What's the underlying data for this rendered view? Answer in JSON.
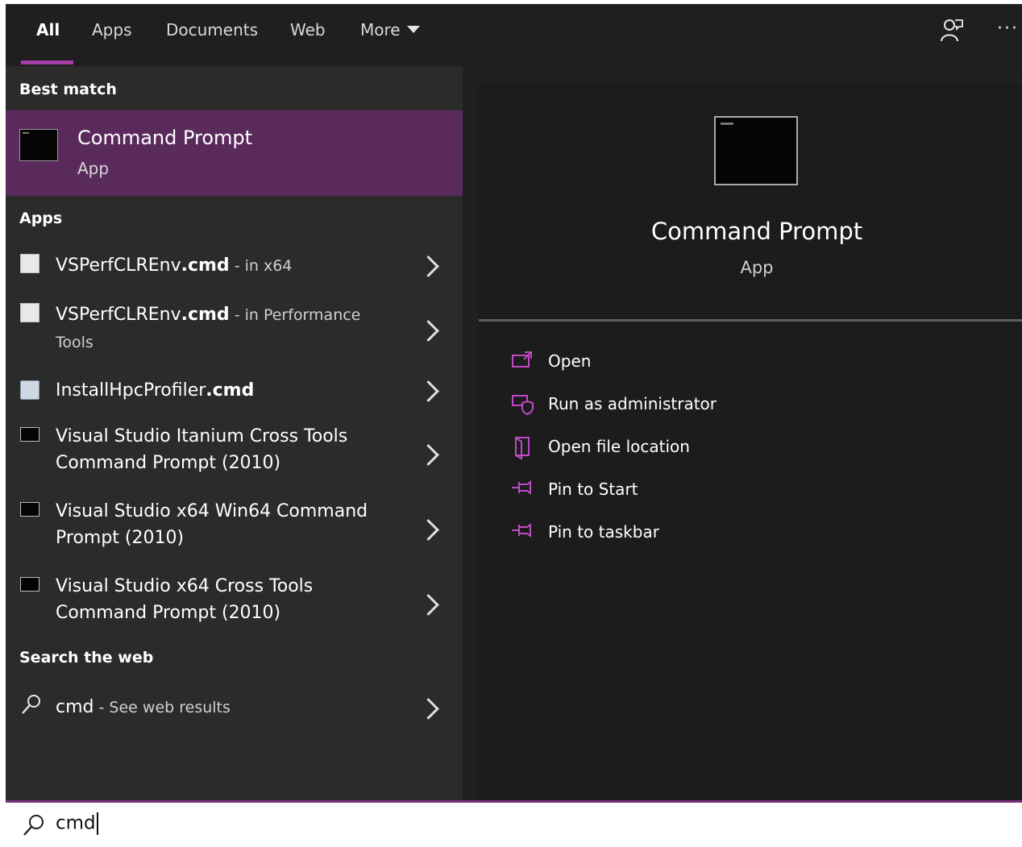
{
  "tabs": [
    {
      "label": "All",
      "active": true
    },
    {
      "label": "Apps"
    },
    {
      "label": "Documents"
    },
    {
      "label": "Web"
    },
    {
      "label": "More"
    }
  ],
  "top_icons": {
    "feedback": "feedback-icon",
    "more": "ellipsis-icon"
  },
  "ellipsis": "···",
  "sections": {
    "best_match": "Best match",
    "apps": "Apps",
    "web": "Search the web"
  },
  "best_match": {
    "title": "Command Prompt",
    "subtitle": "App"
  },
  "apps": [
    {
      "name": "VSPerfCLREnv",
      "ext": ".cmd",
      "loc": " - in x64",
      "line2": ""
    },
    {
      "name": "VSPerfCLREnv",
      "ext": ".cmd",
      "loc": " - in Performance",
      "line2": "Tools"
    },
    {
      "name": "InstallHpcProfiler",
      "ext": ".cmd",
      "loc": "",
      "line2": ""
    },
    {
      "line1": "Visual Studio Itanium Cross Tools",
      "line2": "Command Prompt (2010)"
    },
    {
      "line1": "Visual Studio x64 Win64 Command",
      "line2": "Prompt (2010)"
    },
    {
      "line1": "Visual Studio x64 Cross Tools",
      "line2": "Command Prompt (2010)"
    }
  ],
  "web_result": {
    "query": "cmd",
    "suffix": " - See web results"
  },
  "details": {
    "title": "Command Prompt",
    "subtitle": "App"
  },
  "actions": [
    {
      "label": "Open",
      "icon": "open-icon"
    },
    {
      "label": "Run as administrator",
      "icon": "shield-icon"
    },
    {
      "label": "Open file location",
      "icon": "folder-icon"
    },
    {
      "label": "Pin to Start",
      "icon": "pin-icon"
    },
    {
      "label": "Pin to taskbar",
      "icon": "pin-icon"
    }
  ],
  "search": {
    "value": "cmd"
  },
  "colors": {
    "accent": "#a43ea6",
    "selected": "#5a2a5c",
    "panel": "#2b2b2b",
    "detail": "#1c1c1c"
  }
}
